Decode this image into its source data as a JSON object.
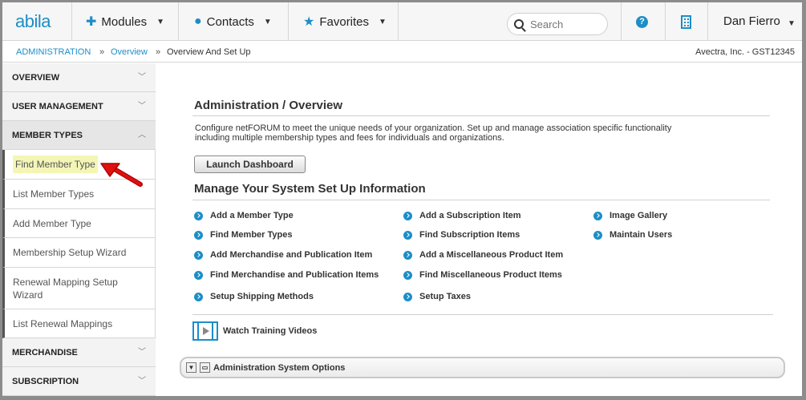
{
  "header": {
    "logo": "abila",
    "nav": [
      {
        "label": "Modules",
        "icon": "puzzle-icon"
      },
      {
        "label": "Contacts",
        "icon": "person-icon"
      },
      {
        "label": "Favorites",
        "icon": "star-icon"
      }
    ],
    "search_placeholder": "Search",
    "user_name": "Dan Fierro"
  },
  "breadcrumb": {
    "items": [
      "ADMINISTRATION",
      "Overview",
      "Overview And Set Up"
    ],
    "separator": "»",
    "org": "Avectra, Inc. - GST12345"
  },
  "sidebar": {
    "sections": [
      {
        "label": "OVERVIEW"
      },
      {
        "label": "USER MANAGEMENT"
      },
      {
        "label": "MEMBER TYPES"
      },
      {
        "label": "MERCHANDISE"
      },
      {
        "label": "SUBSCRIPTION"
      }
    ],
    "member_type_items": [
      "Find Member Type",
      "List Member Types",
      "Add Member Type",
      "Membership Setup Wizard",
      "Renewal Mapping Setup Wizard",
      "List Renewal Mappings"
    ],
    "active_item": "Find Member Type"
  },
  "main": {
    "title": "Administration / Overview",
    "description": "Configure netFORUM to meet the unique needs of your organization. Set up and manage association specific functionality including multiple membership types and fees for individuals and organizations.",
    "dashboard_button": "Launch Dashboard",
    "setup_title": "Manage Your System Set Up Information",
    "links_col1": [
      "Add a Member Type",
      "Find Member Types",
      "Add Merchandise and Publication Item",
      "Find Merchandise and Publication Items",
      "Setup Shipping Methods"
    ],
    "links_col2": [
      "Add a Subscription Item",
      "Find Subscription Items",
      "Add a Miscellaneous Product Item",
      "Find Miscellaneous Product Items",
      "Setup Taxes"
    ],
    "links_col3": [
      "Image Gallery",
      "Maintain Users"
    ],
    "training_link": "Watch Training Videos",
    "options_title": "Administration System Options"
  },
  "colors": {
    "accent": "#1c8ec7",
    "highlight": "#f4f6b6",
    "arrow": "#e01010"
  }
}
